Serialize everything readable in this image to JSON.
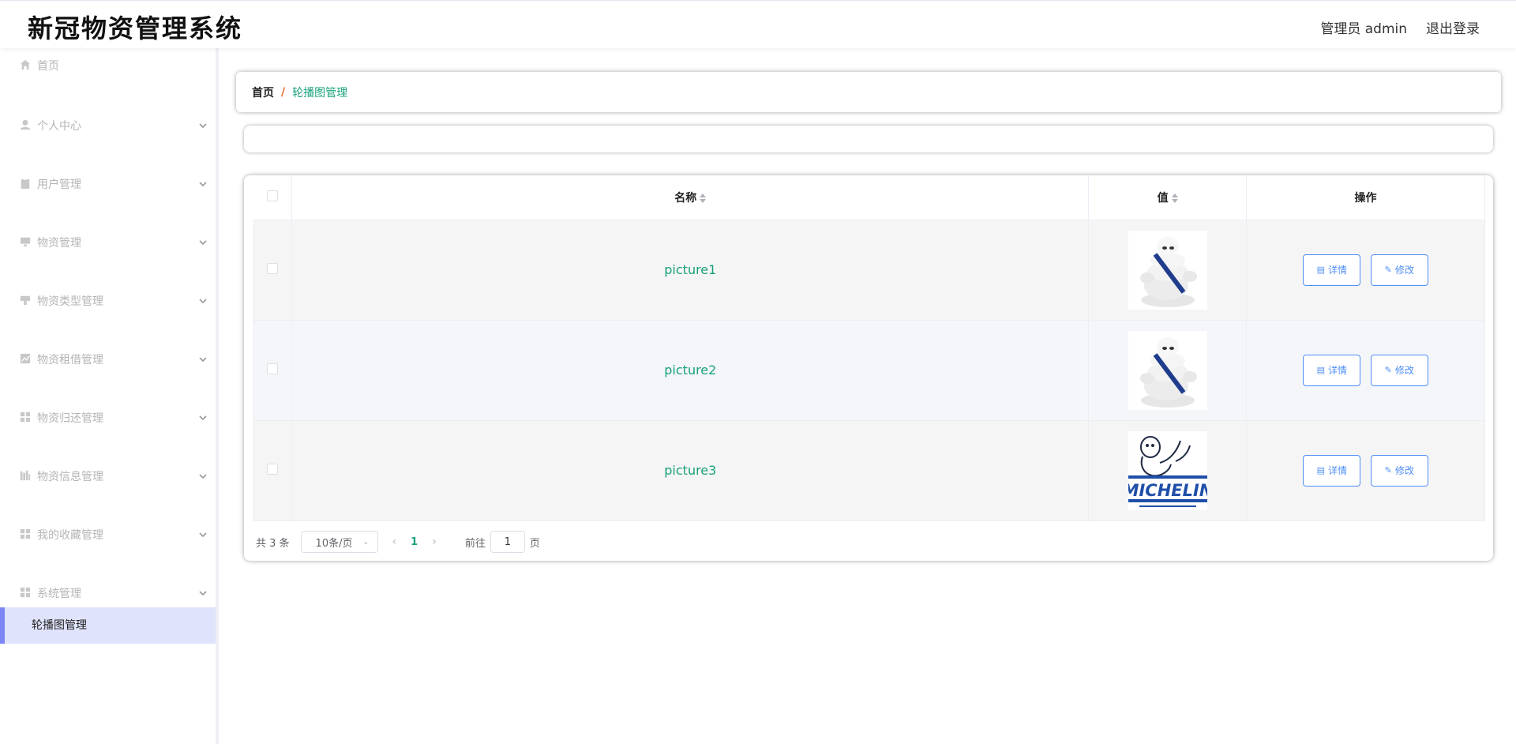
{
  "header": {
    "app_title": "新冠物资管理系统",
    "user_label": "管理员 admin",
    "logout_label": "退出登录"
  },
  "sidebar": {
    "items": [
      {
        "label": "首页",
        "icon": "home-icon",
        "has_chevron": false
      },
      {
        "label": "个人中心",
        "icon": "user-icon",
        "has_chevron": true
      },
      {
        "label": "用户管理",
        "icon": "clipboard-icon",
        "has_chevron": true
      },
      {
        "label": "物资管理",
        "icon": "monitor-icon",
        "has_chevron": true
      },
      {
        "label": "物资类型管理",
        "icon": "tag-icon",
        "has_chevron": true
      },
      {
        "label": "物资租借管理",
        "icon": "chart-icon",
        "has_chevron": true
      },
      {
        "label": "物资归还管理",
        "icon": "grid-icon",
        "has_chevron": true
      },
      {
        "label": "物资信息管理",
        "icon": "bars-icon",
        "has_chevron": true
      },
      {
        "label": "我的收藏管理",
        "icon": "grid-icon",
        "has_chevron": true
      },
      {
        "label": "系统管理",
        "icon": "grid-icon",
        "has_chevron": true
      }
    ],
    "active_sub": "轮播图管理"
  },
  "breadcrumb": {
    "home": "首页",
    "separator": "/",
    "current": "轮播图管理"
  },
  "table": {
    "headers": {
      "name": "名称",
      "value": "值",
      "actions": "操作"
    },
    "rows": [
      {
        "name": "picture1",
        "image": "michelin-man-photo"
      },
      {
        "name": "picture2",
        "image": "michelin-man-photo"
      },
      {
        "name": "picture3",
        "image": "michelin-logo"
      }
    ],
    "detail_label": "详情",
    "edit_label": "修改"
  },
  "pagination": {
    "total": "共 3 条",
    "page_size": "10条/页",
    "current_page": "1",
    "goto_label": "前往",
    "goto_value": "1",
    "page_suffix": "页"
  },
  "colors": {
    "accent_green": "#19a17b",
    "accent_blue": "#4f8ef7",
    "sidebar_active": "#dfe3fb",
    "sidebar_active_bar": "#7b87f4"
  }
}
